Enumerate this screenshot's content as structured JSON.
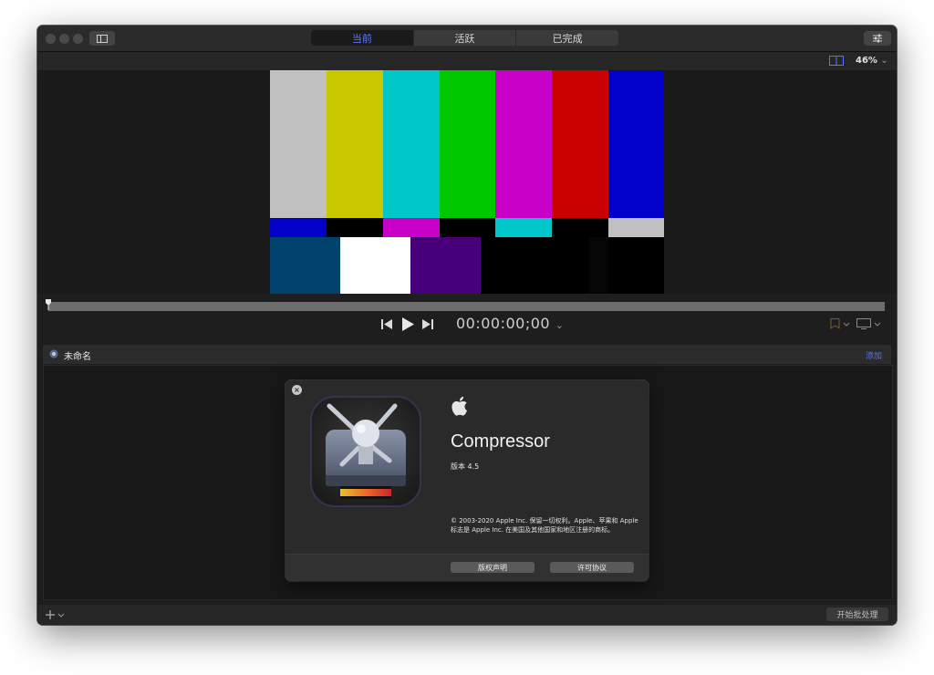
{
  "window": {
    "tabs": [
      {
        "label": "当前",
        "active": true
      },
      {
        "label": "活跃",
        "active": false
      },
      {
        "label": "已完成",
        "active": false
      }
    ]
  },
  "viewer": {
    "zoom": "46%",
    "timecode": "00:00:00;00"
  },
  "batch": {
    "title": "未命名",
    "add_label": "添加",
    "start_label": "开始批处理"
  },
  "about": {
    "app_name": "Compressor",
    "version": "版本 4.5",
    "copyright": "© 2003-2020 Apple Inc. 保留一切权利。Apple、苹果和 Apple 标志是 Apple Inc. 在美国及其他国家和地区注册的商标。",
    "buttons": {
      "copyright_notice": "版权声明",
      "license": "许可协议"
    }
  },
  "colors": {
    "accent": "#5b7bff",
    "link": "#4f76ff",
    "window_bg": "#1e1e1e"
  },
  "icons": [
    "sidebar-toggle-icon",
    "inspector-icon",
    "viewer-layout-icon",
    "skip-back-icon",
    "play-icon",
    "skip-forward-icon",
    "marker-icon",
    "display-icon",
    "batch-settings-icon",
    "add-icon",
    "close-icon",
    "apple-logo-icon",
    "compressor-app-icon"
  ]
}
